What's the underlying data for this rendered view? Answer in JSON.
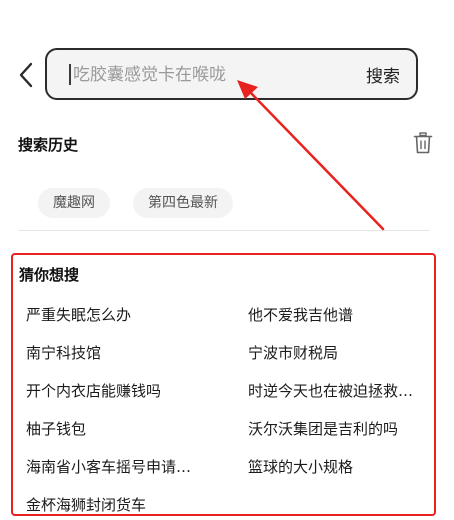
{
  "search": {
    "placeholder": "吃胶囊感觉卡在喉咙",
    "button_label": "搜索"
  },
  "history": {
    "title": "搜索历史",
    "items": [
      "魔趣网",
      "第四色最新"
    ]
  },
  "suggestions": {
    "title": "猜你想搜",
    "left": [
      "严重失眠怎么办",
      "南宁科技馆",
      "开个内衣店能赚钱吗",
      "柚子钱包",
      "海南省小客车摇号申请…",
      "金杯海狮封闭货车"
    ],
    "right": [
      "他不爱我吉他谱",
      "宁波市财税局",
      "时逆今天也在被迫拯救…",
      "沃尔沃集团是吉利的吗",
      "篮球的大小规格"
    ]
  },
  "colors": {
    "annotation": "#e8231f",
    "accent_border": "#2b2b2b"
  },
  "icons": {
    "back": "chevron-left-icon",
    "trash": "trash-icon"
  }
}
